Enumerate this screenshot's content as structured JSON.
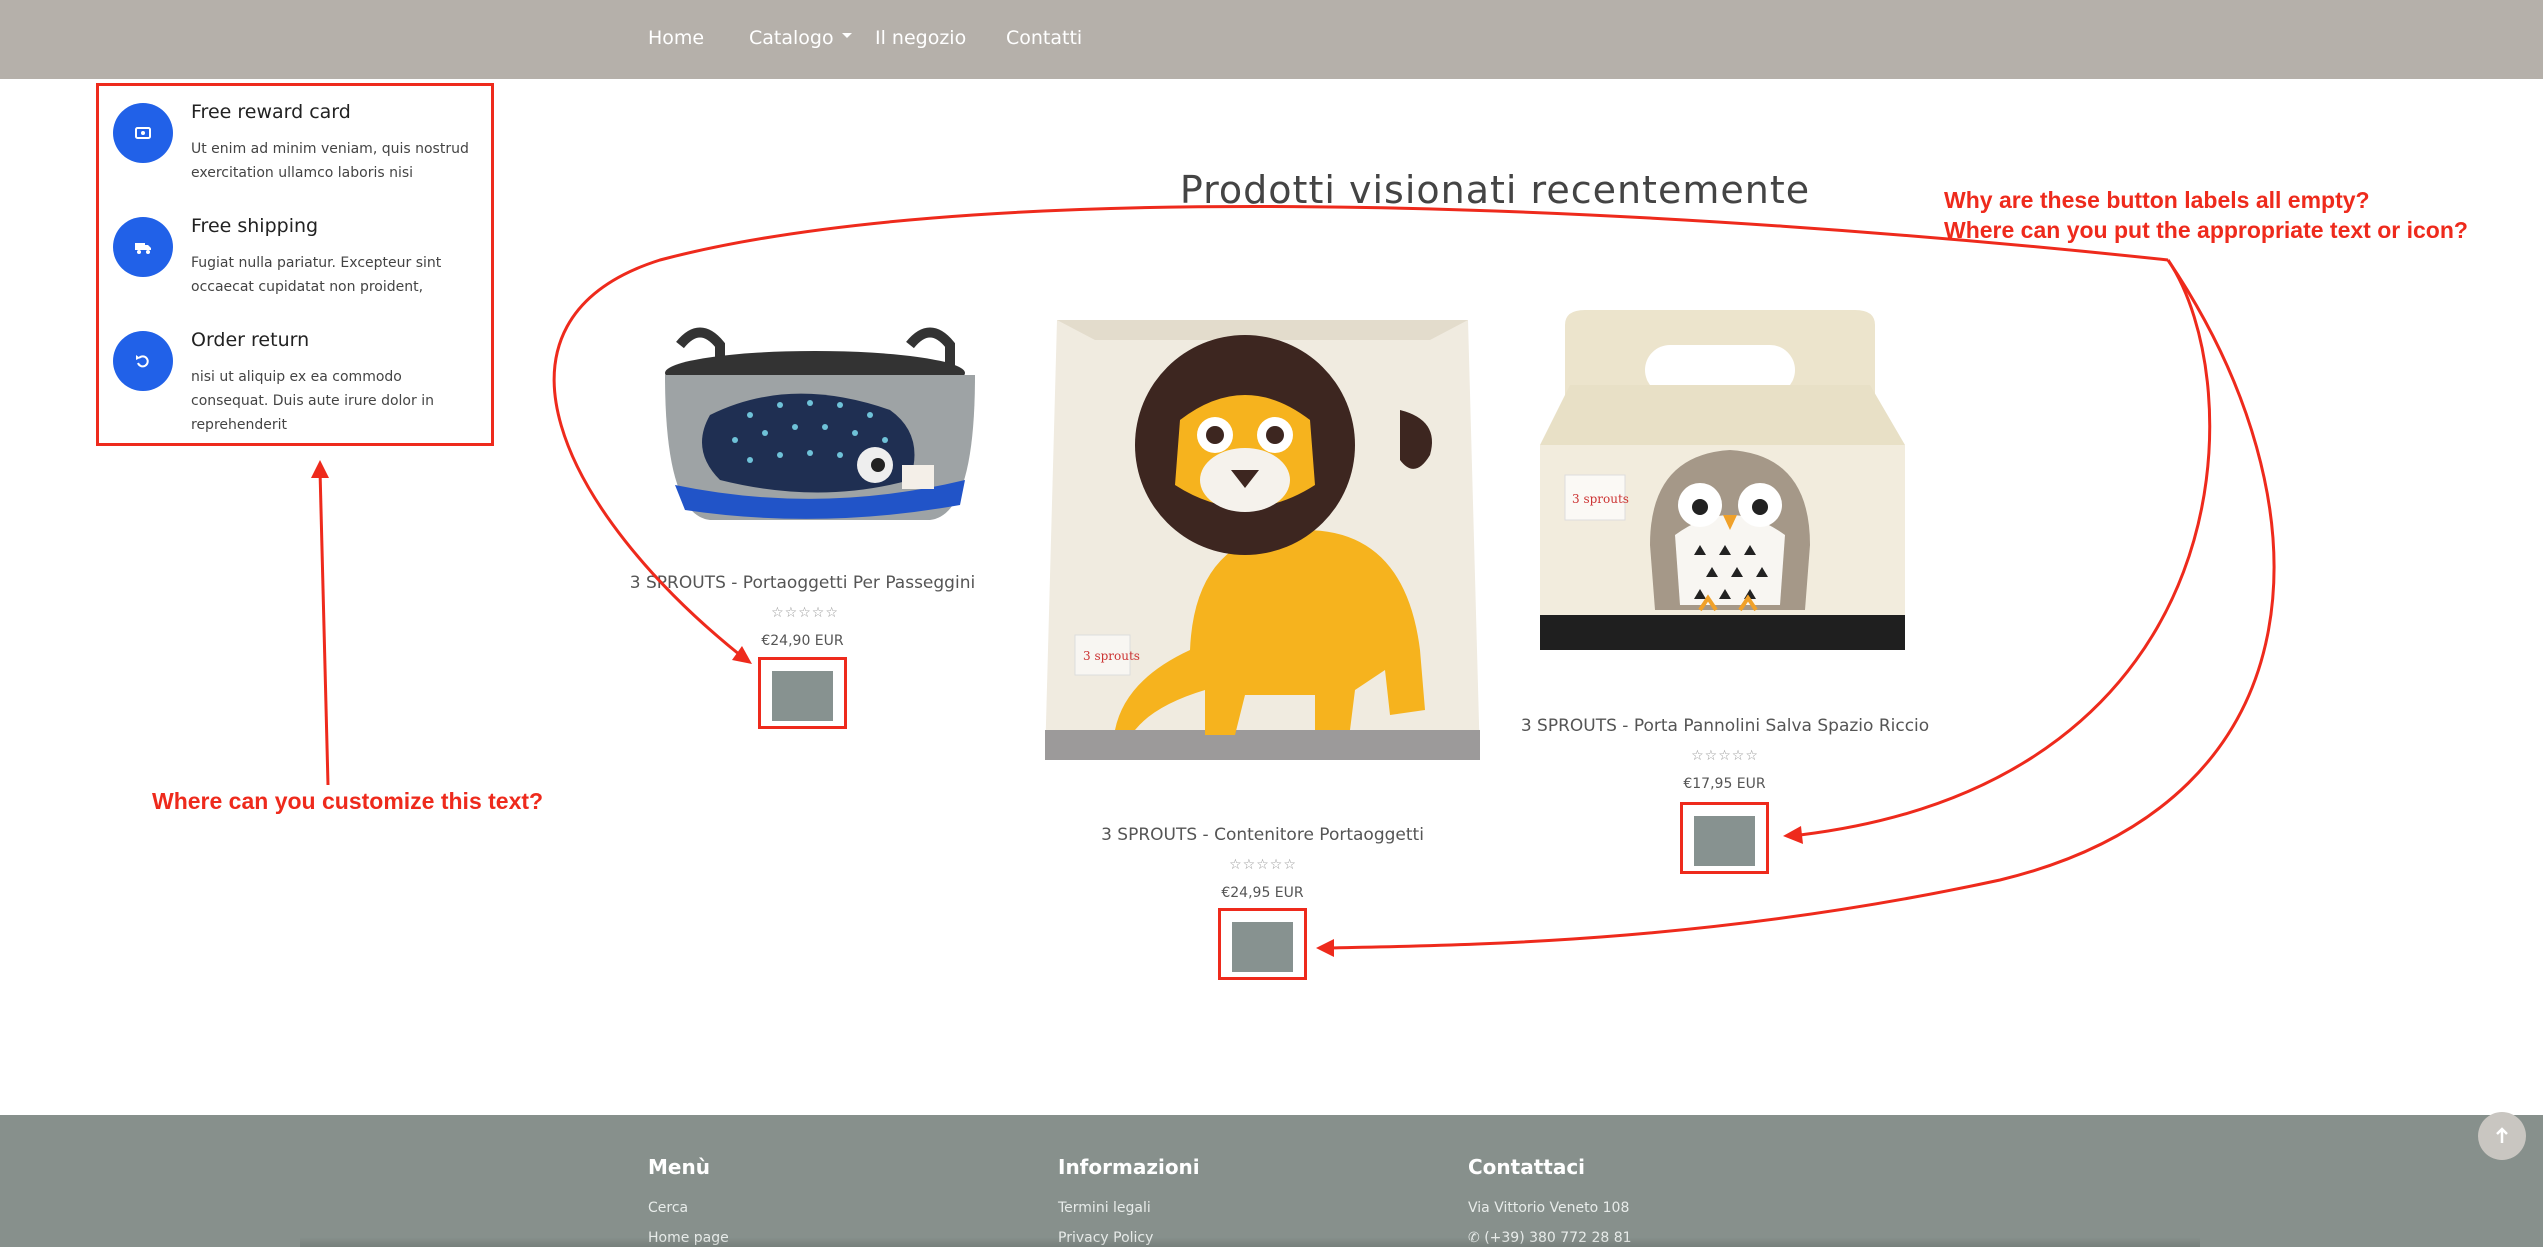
{
  "nav": {
    "items": [
      {
        "label": "Home"
      },
      {
        "label": "Catalogo"
      },
      {
        "label": "Il negozio"
      },
      {
        "label": "Contatti"
      }
    ]
  },
  "features": [
    {
      "icon": "card-icon",
      "title": "Free reward card",
      "desc": "Ut enim ad minim veniam, quis nostrud exercitation ullamco laboris nisi"
    },
    {
      "icon": "truck-icon",
      "title": "Free shipping",
      "desc": "Fugiat nulla pariatur. Excepteur sint occaecat cupidatat non proident,"
    },
    {
      "icon": "undo-icon",
      "title": "Order return",
      "desc": "nisi ut aliquip ex ea commodo consequat. Duis aute irure dolor in reprehenderit"
    }
  ],
  "section": {
    "title": "Prodotti visionati recentemente"
  },
  "products": [
    {
      "name": "3 SPROUTS - Portaoggetti Per Passeggini",
      "price": "€24,90 EUR",
      "stars": "☆☆☆☆☆",
      "button_label": ""
    },
    {
      "name": "3 SPROUTS - Contenitore Portaoggetti",
      "price": "€24,95 EUR",
      "stars": "☆☆☆☆☆",
      "button_label": ""
    },
    {
      "name": "3 SPROUTS - Porta Pannolini Salva Spazio Riccio",
      "price": "€17,95 EUR",
      "stars": "☆☆☆☆☆",
      "button_label": ""
    }
  ],
  "annotations": {
    "buttons_line1": "Why are these button labels all empty?",
    "buttons_line2": "Where can you put the appropriate text or icon?",
    "customize": "Where can you customize this text?"
  },
  "footer": {
    "columns": [
      {
        "title": "Menù",
        "links": [
          "Cerca",
          "Home page"
        ]
      },
      {
        "title": "Informazioni",
        "links": [
          "Termini legali",
          "Privacy Policy"
        ]
      },
      {
        "title": "Contattaci",
        "links": [
          "Via Vittorio Veneto 108",
          "(+39) 380 772 28 81"
        ]
      }
    ]
  },
  "colors": {
    "nav_bg": "#b5b0aa",
    "accent_blue": "#2161e8",
    "annotation_red": "#ee2a1c",
    "button_gray": "#879290",
    "footer_bg": "#87908c"
  }
}
